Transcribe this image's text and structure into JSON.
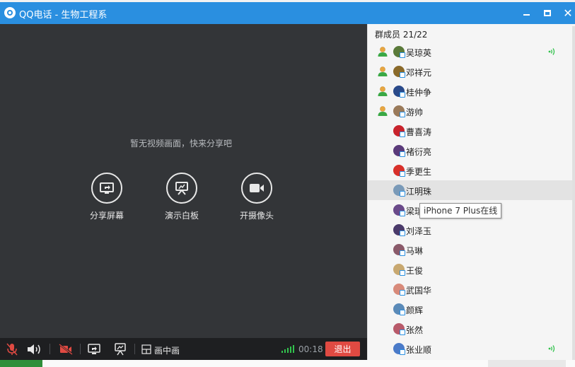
{
  "window": {
    "title": "QQ电话 - 生物工程系"
  },
  "video_area": {
    "hint": "暂无视频画面，快来分享吧",
    "actions": [
      {
        "label": "分享屏幕",
        "icon": "share-screen-icon"
      },
      {
        "label": "演示白板",
        "icon": "whiteboard-icon"
      },
      {
        "label": "开摄像头",
        "icon": "camera-icon"
      }
    ]
  },
  "toolbar": {
    "pip_label": "画中画",
    "timer": "00:18",
    "exit_label": "退出",
    "mic_state": "muted",
    "camera_state": "off"
  },
  "members": {
    "header": "群成员 21/22",
    "list": [
      {
        "name": "吴琼英",
        "host": true,
        "speaking": true,
        "avatar_color": "#5a7a3a"
      },
      {
        "name": "邓祥元",
        "host": true,
        "speaking": false,
        "avatar_color": "#8a6a2a"
      },
      {
        "name": "桂仲争",
        "host": true,
        "speaking": false,
        "avatar_color": "#2a4a8a"
      },
      {
        "name": "游帅",
        "host": true,
        "speaking": false,
        "avatar_color": "#9a7a5a"
      },
      {
        "name": "曹喜涛",
        "host": false,
        "speaking": false,
        "avatar_color": "#c8232c"
      },
      {
        "name": "褚衍亮",
        "host": false,
        "speaking": false,
        "avatar_color": "#5a3a7a"
      },
      {
        "name": "季更生",
        "host": false,
        "speaking": false,
        "avatar_color": "#d8302a"
      },
      {
        "name": "江明珠",
        "host": false,
        "speaking": false,
        "avatar_color": "#7a9ab8",
        "highlighted": true
      },
      {
        "name": "梁瑞",
        "host": false,
        "speaking": false,
        "avatar_color": "#6a4a8a"
      },
      {
        "name": "刘泽玉",
        "host": false,
        "speaking": false,
        "avatar_color": "#4a3a6a"
      },
      {
        "name": "马琳",
        "host": false,
        "speaking": false,
        "avatar_color": "#8a5a6a"
      },
      {
        "name": "王俊",
        "host": false,
        "speaking": false,
        "avatar_color": "#c8a870"
      },
      {
        "name": "武国华",
        "host": false,
        "speaking": false,
        "avatar_color": "#d88a7a"
      },
      {
        "name": "颜辉",
        "host": false,
        "speaking": false,
        "avatar_color": "#5a8ab8"
      },
      {
        "name": "张然",
        "host": false,
        "speaking": false,
        "avatar_color": "#b85a6a"
      },
      {
        "name": "张业顺",
        "host": false,
        "speaking": true,
        "avatar_color": "#4a7ac8"
      }
    ]
  },
  "tooltip": {
    "text": "iPhone 7 Plus在线"
  },
  "colors": {
    "titlebar": "#2a8fe0",
    "video_bg": "#333538",
    "toolbar_bg": "#1e1f21",
    "exit_button": "#e04a42",
    "speaking_green": "#32c24d",
    "muted_red": "#e04a42"
  }
}
